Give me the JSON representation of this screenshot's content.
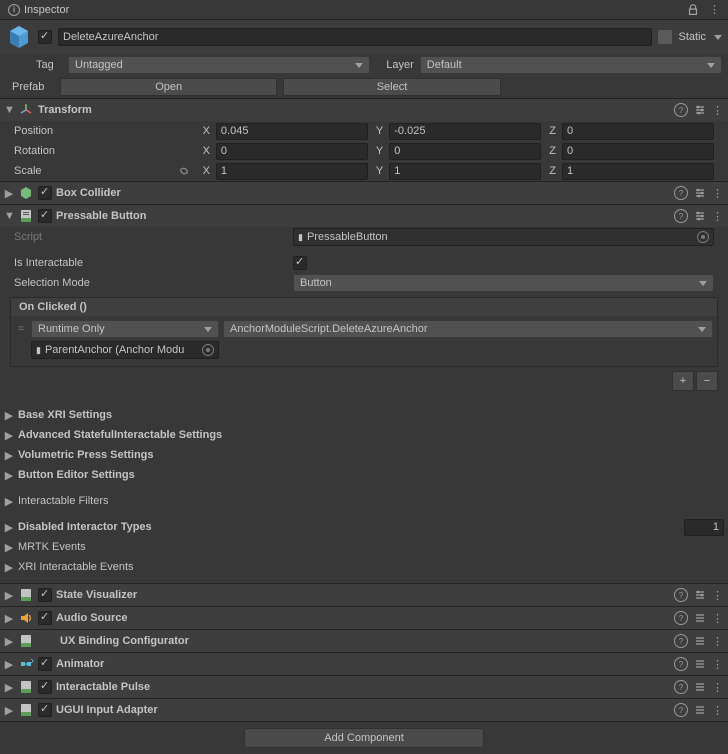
{
  "panel_title": "Inspector",
  "obj_name": "DeleteAzureAnchor",
  "static_label": "Static",
  "tag_label": "Tag",
  "tag_value": "Untagged",
  "layer_label": "Layer",
  "layer_value": "Default",
  "prefab_label": "Prefab",
  "open_label": "Open",
  "select_label": "Select",
  "transform": {
    "title": "Transform",
    "position": "Position",
    "rotation": "Rotation",
    "scale": "Scale",
    "pos": {
      "x": "0.045",
      "y": "-0.025",
      "z": "0"
    },
    "rot": {
      "x": "0",
      "y": "0",
      "z": "0"
    },
    "scl": {
      "x": "1",
      "y": "1",
      "z": "1"
    }
  },
  "box_collider": {
    "title": "Box Collider"
  },
  "pressable": {
    "title": "Pressable Button",
    "script_label": "Script",
    "script_value": "PressableButton",
    "interactable_label": "Is Interactable",
    "selection_label": "Selection Mode",
    "selection_value": "Button",
    "onclicked_label": "On Clicked ()",
    "runtime_value": "Runtime Only",
    "method_value": "AnchorModuleScript.DeleteAzureAnchor",
    "target_value": "ParentAnchor (Anchor Modu"
  },
  "groups": {
    "base_xri": "Base XRI Settings",
    "adv_stateful": "Advanced StatefulInteractable Settings",
    "vol_press": "Volumetric Press Settings",
    "btn_editor": "Button Editor Settings",
    "filters": "Interactable Filters",
    "disabled_interactor": "Disabled Interactor Types",
    "disabled_count": "1",
    "mrtk_events": "MRTK Events",
    "xri_events": "XRI Interactable Events"
  },
  "comps": {
    "state_vis": "State Visualizer",
    "audio": "Audio Source",
    "ux_binding": "UX Binding Configurator",
    "animator": "Animator",
    "pulse": "Interactable Pulse",
    "ugui": "UGUI Input Adapter"
  },
  "add_component": "Add Component"
}
